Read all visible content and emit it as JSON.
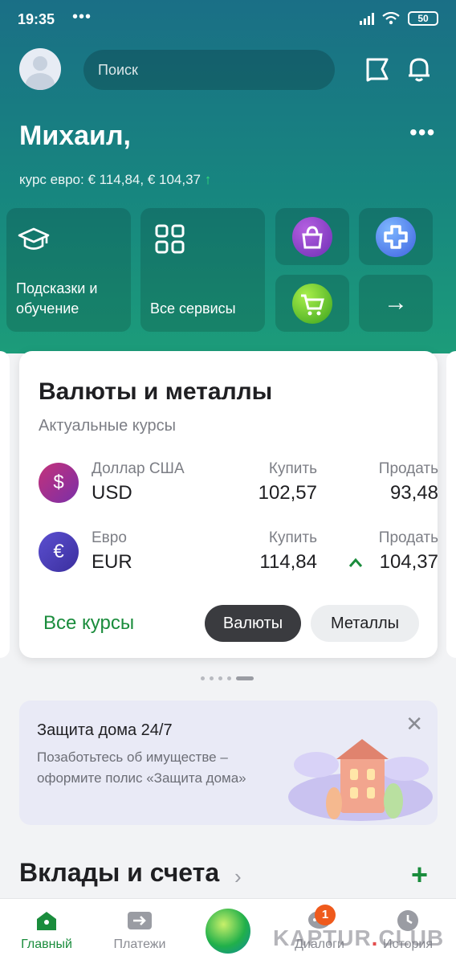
{
  "status_bar": {
    "time": "19:35",
    "dots": "•••",
    "battery": "50"
  },
  "header": {
    "search_placeholder": "Поиск",
    "greeting": "Михаил,",
    "rate_text": "курс евро: € 114,84, € 104,37",
    "rate_arrow": "↑"
  },
  "tiles": {
    "tips_label": "Подсказки и обучение",
    "services_label": "Все сервисы",
    "arrow": "→"
  },
  "currency_card": {
    "title": "Валюты и металлы",
    "subtitle": "Актуальные курсы",
    "buy_label": "Купить",
    "sell_label": "Продать",
    "rows": [
      {
        "symbol": "$",
        "name": "Доллар США",
        "code": "USD",
        "buy": "102,57",
        "sell": "93,48"
      },
      {
        "symbol": "€",
        "name": "Евро",
        "code": "EUR",
        "buy": "114,84",
        "sell": "104,37"
      }
    ],
    "all_rates": "Все курсы",
    "tab_currencies": "Валюты",
    "tab_metals": "Металлы"
  },
  "promo": {
    "title": "Защита дома 24/7",
    "text": "Позаботьтесь об имуществе – оформите полис «Защита дома»",
    "close": "✕"
  },
  "section": {
    "title": "Вклады и счета",
    "chevron": "›",
    "add": "+"
  },
  "tabbar": {
    "home": "Главный",
    "payments": "Платежи",
    "dialogs": "Диалоги",
    "history": "История",
    "badge": "1"
  },
  "watermark": {
    "left": "KAPTUR",
    "dot": ".",
    "right": "CLUB"
  },
  "colors": {
    "accent": "#1a8c3c",
    "hero_top": "#1a6f86",
    "hero_bottom": "#1c9c7a",
    "badge": "#ef5a1c"
  }
}
